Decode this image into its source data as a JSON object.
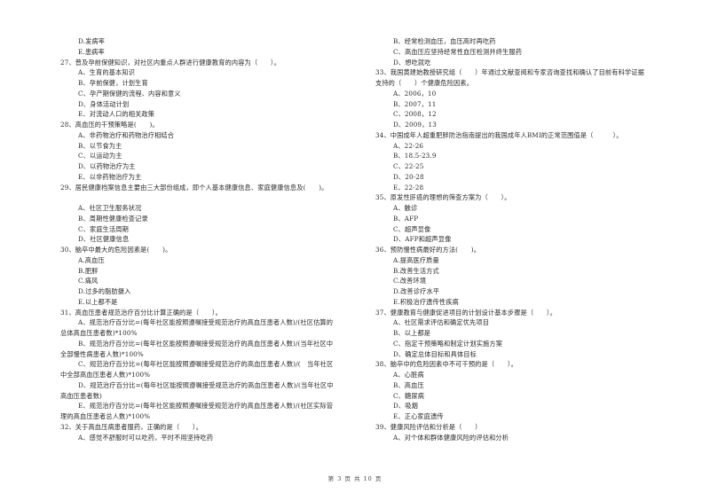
{
  "left_column": [
    {
      "type": "opt",
      "text": "D.发病率"
    },
    {
      "type": "opt",
      "text": "E.患病率"
    },
    {
      "type": "q",
      "text": "27、普及孕前保健知识，对社区内重点人群进行健康教育的内容为（　　）。"
    },
    {
      "type": "opt",
      "text": "A、生育的基本知识"
    },
    {
      "type": "opt",
      "text": "B、孕前保健，计划生育"
    },
    {
      "type": "opt",
      "text": "C、孕产期保健的流程、内容和意义"
    },
    {
      "type": "opt",
      "text": "D、身体活动计划"
    },
    {
      "type": "opt",
      "text": "E、对流动人口的相关政策"
    },
    {
      "type": "q",
      "text": "28、高血压的干预策略是(　　)。"
    },
    {
      "type": "opt",
      "text": "A、非药物治疗和药物治疗相结合"
    },
    {
      "type": "opt",
      "text": "B、以节食为主"
    },
    {
      "type": "opt",
      "text": "C、以运动为主"
    },
    {
      "type": "opt",
      "text": "D、以药物治疗为主"
    },
    {
      "type": "opt",
      "text": "E、以非药物治疗为主"
    },
    {
      "type": "q",
      "text": "29、居民健康档案信息主要由三大部份组成，即个人基本健康信息、家庭健康信息及(　　)。"
    },
    {
      "type": "blank",
      "text": ""
    },
    {
      "type": "opt",
      "text": "A、社区卫生服务状况"
    },
    {
      "type": "opt",
      "text": "B、周期性健康检查记录"
    },
    {
      "type": "opt",
      "text": "C、家庭生活周期"
    },
    {
      "type": "opt",
      "text": "D、社区健康信息"
    },
    {
      "type": "q",
      "text": "30、脑卒中最大的危险因素是(　　)。"
    },
    {
      "type": "opt",
      "text": "A.高血压"
    },
    {
      "type": "opt",
      "text": "B.肥胖"
    },
    {
      "type": "opt",
      "text": "C.痛风"
    },
    {
      "type": "opt",
      "text": "D.过多的脂肪摄入"
    },
    {
      "type": "opt",
      "text": "E.以上都不是"
    },
    {
      "type": "q",
      "text": "31、高血压患者规范治疗百分比计算正确的是（　　）。"
    },
    {
      "type": "opt",
      "text": "A、规范治疗百分比=(每年社区能按照遵嘱接受规范治疗的高血压患者人数)/(社区估算的"
    },
    {
      "type": "cont",
      "text": "总体高血压患者数)*100%"
    },
    {
      "type": "opt",
      "text": "B、规范治疗百分比=(每年社区能按照遵嘱接受规范治疗的高血压患者人数)/(当年社区中"
    },
    {
      "type": "cont",
      "text": "全部慢性病患者人数)*100%"
    },
    {
      "type": "opt",
      "text": "C、规范治疗百分比=(每年社区能按照遵嘱接受规范治疗的高血压患者人数)/(　当年社区"
    },
    {
      "type": "cont",
      "text": "中全部高血压患者人数)*100%"
    },
    {
      "type": "opt",
      "text": "D、规范治疗百分比=(每年社区能按照遵嘱接受规范治疗的高血压患者人数)/(当年社区中"
    },
    {
      "type": "cont",
      "text": "高血压患者数)"
    },
    {
      "type": "opt",
      "text": "E、规范治疗百分比=(每年社区能按照遵嘱接受规范治疗的高血压患者人数)/(社区实际管"
    },
    {
      "type": "cont",
      "text": "理的高血压患者总人数)*100%"
    },
    {
      "type": "q",
      "text": "32、关于高血压病患者服药，正确的是（　　）。"
    },
    {
      "type": "opt",
      "text": "A、感觉不舒服时可以吃药，平时不用坚持吃药"
    }
  ],
  "right_column": [
    {
      "type": "opt",
      "text": "B、经常检测血压，血压高时再吃药"
    },
    {
      "type": "opt",
      "text": "C、高血压应坚持经常性血压检测并终生服药"
    },
    {
      "type": "opt",
      "text": "D、想吃就吃"
    },
    {
      "type": "q",
      "text": "33、我国黄建始教授研究组（　　）年通过文献查阅和专家咨询查找和确认了目前有科学证据"
    },
    {
      "type": "cont",
      "text": "支持的（　　）个健康危险因素。"
    },
    {
      "type": "opt",
      "text": "A、2006，10"
    },
    {
      "type": "opt",
      "text": "B、2007，11"
    },
    {
      "type": "opt",
      "text": "C、2008，12"
    },
    {
      "type": "opt",
      "text": "D、2009，13"
    },
    {
      "type": "q",
      "text": "34、中国成年人超重肥胖防治指南提出的我国成年人BMI的正常范围值是（　　　）。"
    },
    {
      "type": "opt",
      "text": "A、22-26"
    },
    {
      "type": "opt",
      "text": "B、18.5-23.9"
    },
    {
      "type": "opt",
      "text": "C、22-25"
    },
    {
      "type": "opt",
      "text": "D、20-28"
    },
    {
      "type": "opt",
      "text": "E、22-28"
    },
    {
      "type": "q",
      "text": "35、原发性肝癌的理想的筛查方案为（　　）。"
    },
    {
      "type": "opt",
      "text": "A、触诊"
    },
    {
      "type": "opt",
      "text": "B、AFP"
    },
    {
      "type": "opt",
      "text": "C、超声显像"
    },
    {
      "type": "opt",
      "text": "D、AFP和超声显像"
    },
    {
      "type": "q",
      "text": "36、预防慢性病最好的方法(　　)。"
    },
    {
      "type": "opt",
      "text": "A.提高医疗质量"
    },
    {
      "type": "opt",
      "text": "B.改善生活方式"
    },
    {
      "type": "opt",
      "text": "C.改善环境"
    },
    {
      "type": "opt",
      "text": "D.改善诊疗水平"
    },
    {
      "type": "opt",
      "text": "E.积极治疗遗传性疾病"
    },
    {
      "type": "q",
      "text": "37、健康教育与健康促进项目的计划设计基本步骤是（　　）。"
    },
    {
      "type": "opt",
      "text": "A、社区需求评估和确定优先项目"
    },
    {
      "type": "opt",
      "text": "B、以上都是"
    },
    {
      "type": "opt",
      "text": "C、指定干预策略和制定计划实施方案"
    },
    {
      "type": "opt",
      "text": "D、确定总体目标和具体目标"
    },
    {
      "type": "q",
      "text": "38、脑卒中的危险因素中不可干预的是（　　）。"
    },
    {
      "type": "opt",
      "text": "A、心脏病"
    },
    {
      "type": "opt",
      "text": "B、高血压"
    },
    {
      "type": "opt",
      "text": "C、糖尿病"
    },
    {
      "type": "opt",
      "text": "D、吸烟"
    },
    {
      "type": "opt",
      "text": "E、正心家庭遗传"
    },
    {
      "type": "q",
      "text": "39、健康风险评估和分析是（　　）"
    },
    {
      "type": "opt",
      "text": "A、对个体和群体健康风险的评估和分析"
    }
  ],
  "footer": {
    "page_label": "第 3 页 共 10 页"
  }
}
